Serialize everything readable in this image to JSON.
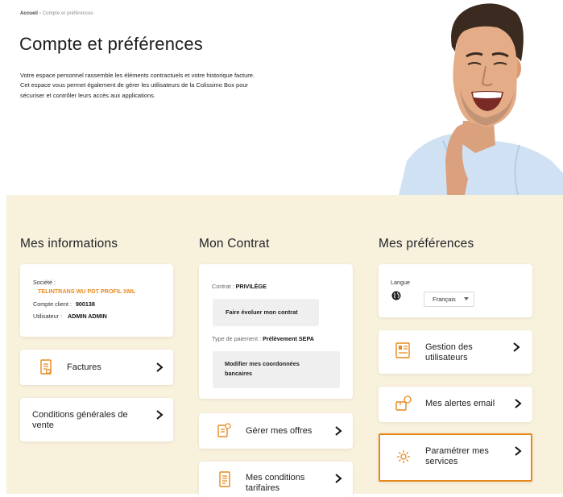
{
  "breadcrumb": {
    "home": "Accueil",
    "separator": "›",
    "current": "Compte et préférences"
  },
  "page": {
    "title": "Compte et préférences",
    "intro": "Votre espace personnel rassemble les éléments contractuels et votre historique facture. Cet espace vous permet également de gérer les utilisateurs de la Colissimo Box pour sécuriser et contrôler leurs accès aux applications."
  },
  "colors": {
    "accent": "#e8891e",
    "panel_bg": "#f8f1dc",
    "card_bg": "#ffffff"
  },
  "columns": {
    "informations": {
      "title": "Mes informations",
      "company_label": "Société :",
      "company_value": "TELINTRANS WU PDT PROFIL XML",
      "client_label": "Compte client :",
      "client_value": "900138",
      "user_label": "Utilisateur :",
      "user_value": "ADMIN ADMIN",
      "links": [
        {
          "label": "Factures",
          "icon": "invoice-icon"
        },
        {
          "label": "Conditions générales de vente"
        }
      ]
    },
    "contrat": {
      "title": "Mon Contrat",
      "contract_label": "Contrat :",
      "contract_value": "PRIVILÈGE",
      "evolve_button": "Faire évoluer mon contrat",
      "payment_label": "Type de paiement :",
      "payment_value": "Prélèvement SEPA",
      "bank_button": "Modifier mes coordonnées bancaires",
      "links": [
        {
          "label": "Gérer mes offres",
          "icon": "offers-icon"
        },
        {
          "label": "Mes conditions tarifaires",
          "icon": "pricing-icon"
        }
      ]
    },
    "preferences": {
      "title": "Mes préférences",
      "language_label": "Langue",
      "language_value": "Français",
      "links": [
        {
          "label": "Gestion des utilisateurs",
          "icon": "users-management-icon"
        },
        {
          "label": "Mes alertes email",
          "icon": "email-alert-icon"
        },
        {
          "label": "Paramétrer mes services",
          "icon": "gear-icon",
          "highlighted": true
        }
      ]
    }
  }
}
